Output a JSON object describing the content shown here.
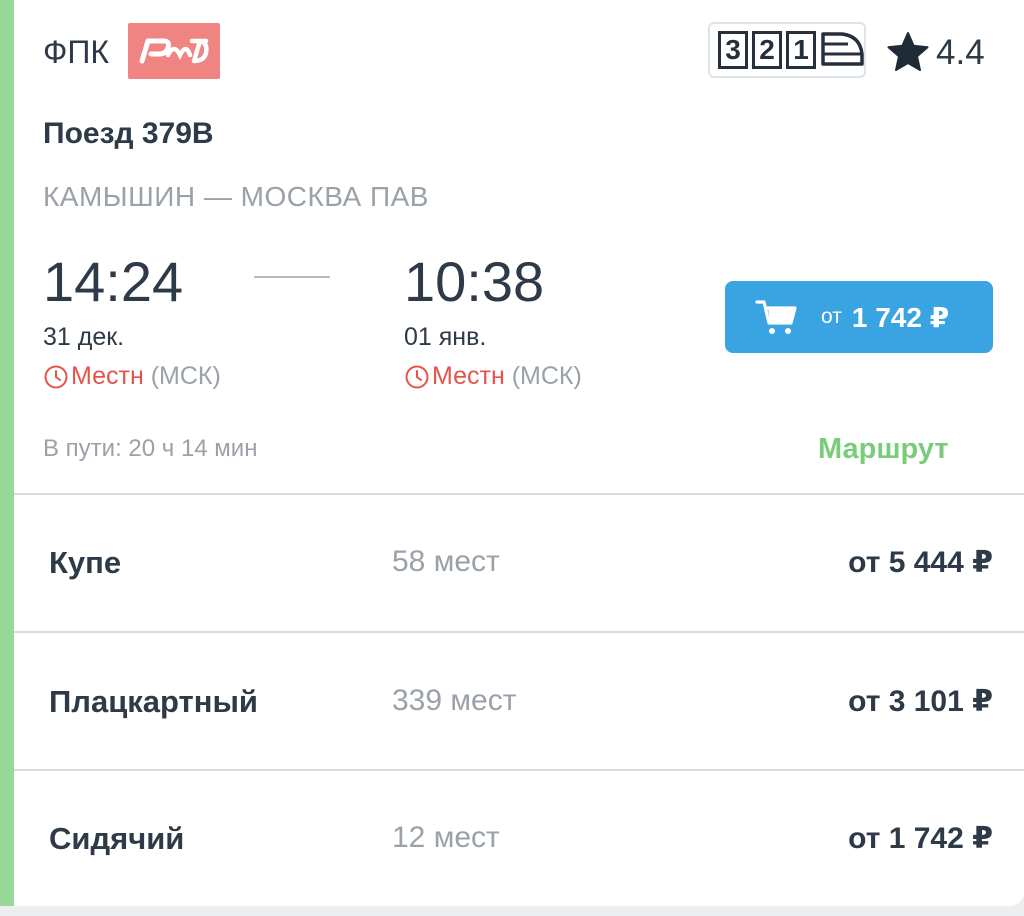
{
  "header": {
    "carrier": "ФПК",
    "logo_text": "РЖД",
    "train_classes": [
      "3",
      "2",
      "1"
    ],
    "rating": "4.4"
  },
  "train": {
    "name": "Поезд 379В",
    "route": "КАМЫШИН — МОСКВА ПАВ"
  },
  "departure": {
    "time": "14:24",
    "date": "31 дек.",
    "tz_local": "Местн",
    "tz_rest": " (МСК)"
  },
  "arrival": {
    "time": "10:38",
    "date": "01 янв.",
    "tz_local": "Местн",
    "tz_rest": " (МСК)"
  },
  "buy": {
    "from": "от",
    "price": "1 742 ₽"
  },
  "duration": "В пути: 20 ч 14 мин",
  "route_link": "Маршрут",
  "classes": [
    {
      "name": "Купе",
      "seats": "58 мест",
      "price": "от 5 444 ₽"
    },
    {
      "name": "Плацкартный",
      "seats": "339 мест",
      "price": "от 3 101 ₽"
    },
    {
      "name": "Сидячий",
      "seats": "12 мест",
      "price": "от 1 742 ₽"
    }
  ],
  "colors": {
    "accent_strip": "#98d898",
    "button": "#3aa3e1",
    "logo_bg": "#f08482",
    "local_time": "#e5534b",
    "route_link": "#7acb7a"
  }
}
